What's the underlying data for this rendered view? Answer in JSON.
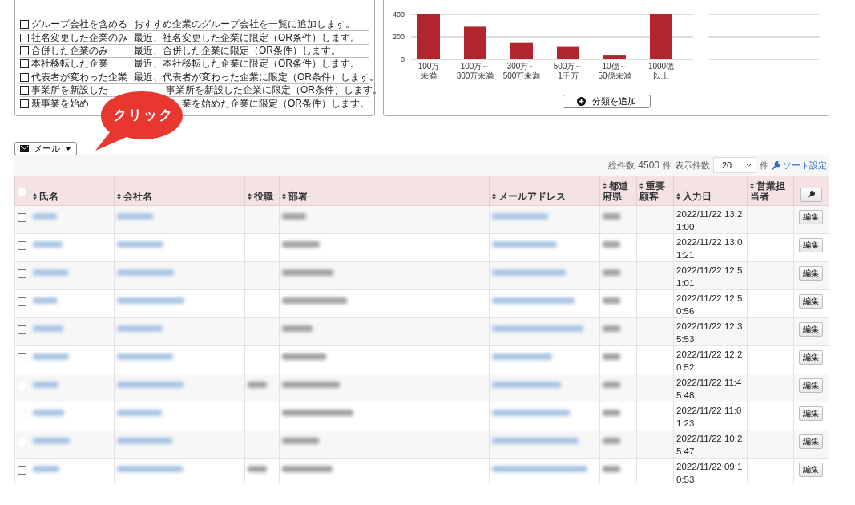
{
  "filter_options": [
    {
      "label": "グループ会社を含める",
      "description": "おすすめ企業のグループ会社を一覧に追加します。",
      "checked": false,
      "covered": false
    },
    {
      "label": "社名変更した企業のみ",
      "description": "最近、社名変更した企業に限定（OR条件）します。",
      "checked": false,
      "covered": false
    },
    {
      "label": "合併した企業のみ",
      "description": "最近、合併した企業に限定（OR条件）します。",
      "checked": false,
      "covered": false
    },
    {
      "label": "本社移転した企業",
      "description": "最近、本社移転した企業に限定（OR条件）します。",
      "checked": false,
      "covered": false
    },
    {
      "label": "代表者が変わった企業",
      "description": "最近、代表者が変わった企業に限定（OR条件）します。",
      "checked": false,
      "covered": false
    },
    {
      "label": "事業所を新設した",
      "description": "事業所を新設した企業に限定（OR条件）します。",
      "checked": false,
      "covered": true
    },
    {
      "label": "新事業を始め",
      "description": "業を始めた企業に限定（OR条件）します。",
      "checked": false,
      "covered": true
    }
  ],
  "chart_panel": {
    "chart_data": {
      "type": "bar",
      "categories": [
        "100万未満",
        "100万～300万未満",
        "300万～500万未満",
        "500万～1千万",
        "10億～50億未満",
        "1000億以上"
      ],
      "series": [
        {
          "color": "#b0262c",
          "values": [
            400,
            290,
            145,
            110,
            35,
            400
          ]
        }
      ],
      "ylim": [
        0,
        400
      ],
      "yticks": [
        0,
        200,
        400
      ]
    },
    "add_button": "分類を追加"
  },
  "callout": {
    "text": "クリック"
  },
  "mail_button": "メール",
  "toolbar": {
    "total_label": "総件数",
    "total": "4500",
    "total_unit": "件",
    "per_page_label": "表示件数",
    "per_page": "20",
    "per_page_unit": "件",
    "sort_link": "ソート設定"
  },
  "table": {
    "select_all_checked": false,
    "columns": [
      "氏名",
      "会社名",
      "役職",
      "部署",
      "メールアドレス",
      "都道府県",
      "重要顧客",
      "入力日",
      "営業担当者"
    ],
    "rows": [
      {
        "checked": false,
        "date": "2022/11/22 13:21:00",
        "edit": "編集"
      },
      {
        "checked": false,
        "date": "2022/11/22 13:01:21",
        "edit": "編集"
      },
      {
        "checked": false,
        "date": "2022/11/22 12:51:01",
        "edit": "編集"
      },
      {
        "checked": false,
        "date": "2022/11/22 12:50:56",
        "edit": "編集"
      },
      {
        "checked": false,
        "date": "2022/11/22 12:35:53",
        "edit": "編集"
      },
      {
        "checked": false,
        "date": "2022/11/22 12:20:52",
        "edit": "編集"
      },
      {
        "checked": false,
        "date": "2022/11/22 11:45:48",
        "edit": "編集"
      },
      {
        "checked": false,
        "date": "2022/11/22 11:01:23",
        "edit": "編集"
      },
      {
        "checked": false,
        "date": "2022/11/22 10:25:47",
        "edit": "編集"
      },
      {
        "checked": false,
        "date": "2022/11/22 09:10:53",
        "edit": "編集"
      }
    ]
  }
}
